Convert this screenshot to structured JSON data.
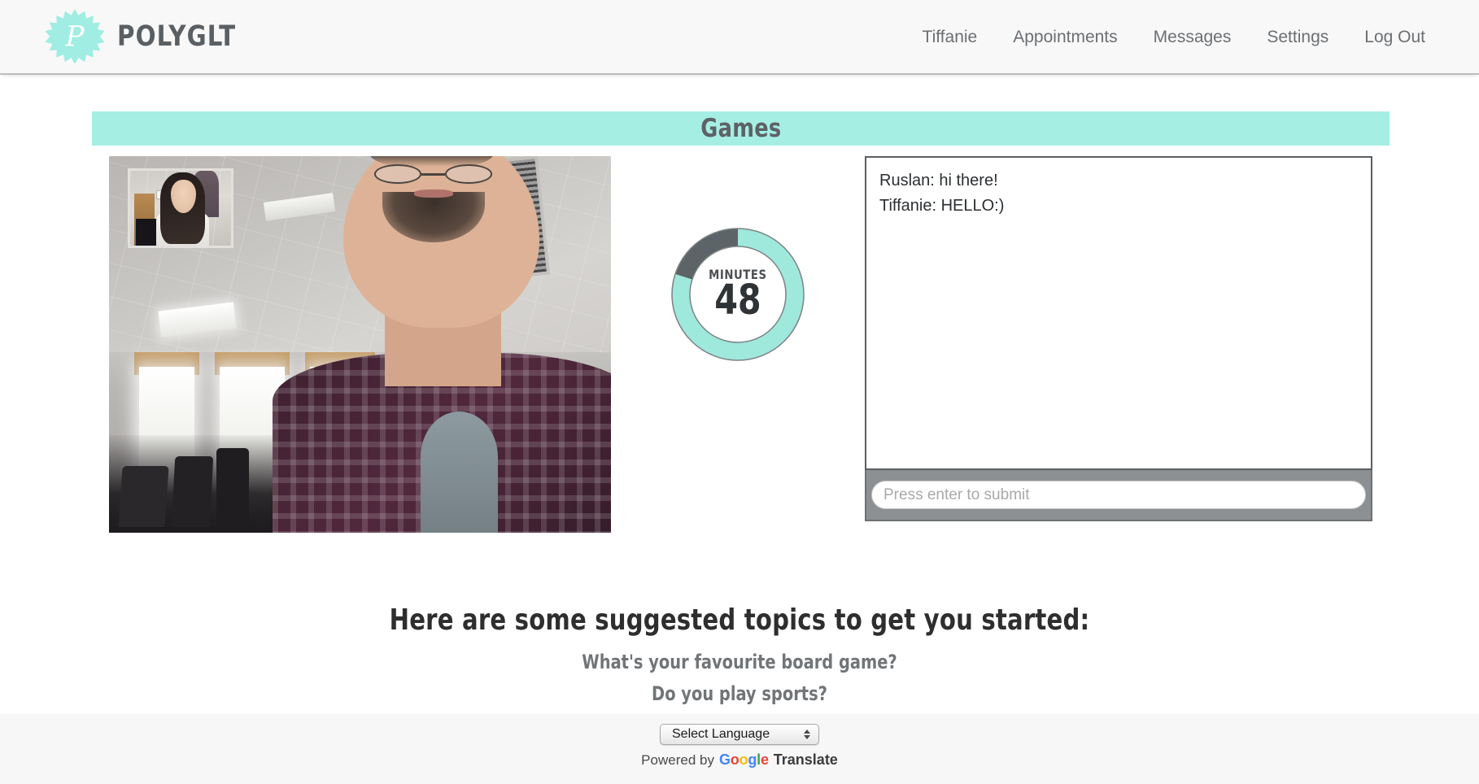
{
  "header": {
    "brand_name": "POLYGLT",
    "logo_icon": "starburst-p-logo",
    "nav": [
      {
        "label": "Tiffanie"
      },
      {
        "label": "Appointments"
      },
      {
        "label": "Messages"
      },
      {
        "label": "Settings"
      },
      {
        "label": "Log Out"
      }
    ]
  },
  "banner": {
    "title": "Games"
  },
  "video": {
    "remote_label": "remote-video-stream",
    "pip_label": "local-video-preview"
  },
  "timer": {
    "label": "MINUTES",
    "value": "48",
    "remaining_fraction": 0.8,
    "arc_color": "#9FE8DC",
    "track_color": "#5D6468"
  },
  "chat": {
    "messages": [
      {
        "text": "Ruslan: hi there!"
      },
      {
        "text": "Tiffanie: HELLO:)"
      }
    ],
    "input_value": "",
    "input_placeholder": "Press enter to submit"
  },
  "suggestions": {
    "title": "Here are some suggested topics to get you started:",
    "items": [
      {
        "text": "What's your favourite board game?"
      },
      {
        "text": "Do you play sports?"
      }
    ]
  },
  "footer": {
    "language_select_value": "Select Language",
    "powered_by": "Powered by",
    "google_letters": [
      "G",
      "o",
      "o",
      "g",
      "l",
      "e"
    ],
    "translate": "Translate"
  },
  "colors": {
    "accent_teal": "#A5EEE4",
    "header_bg": "#F8F8F8",
    "footer_bg": "#F7F7F7",
    "text_gray": "#6B6F73"
  }
}
